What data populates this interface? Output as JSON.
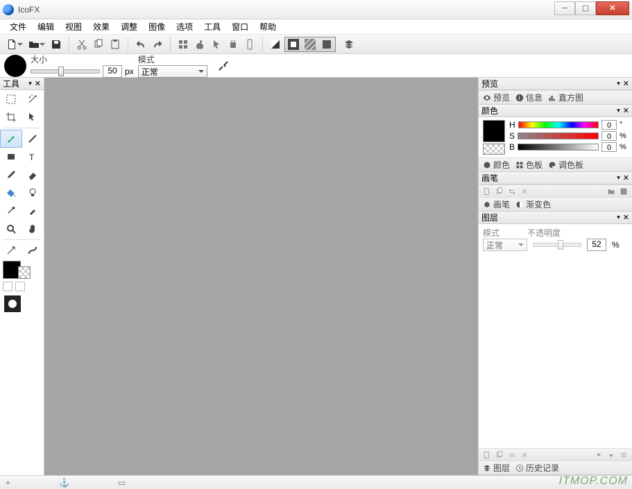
{
  "title": "IcoFX",
  "menu": [
    "文件",
    "编辑",
    "视图",
    "效果",
    "调整",
    "图像",
    "选项",
    "工具",
    "窗口",
    "帮助"
  ],
  "brush": {
    "sizeLabel": "大小",
    "sizeValue": "50",
    "sizeUnit": "px",
    "modeLabel": "模式",
    "modeValue": "正常"
  },
  "toolbox": {
    "title": "工具"
  },
  "preview": {
    "title": "预览",
    "tabs": [
      "预览",
      "信息",
      "直方图"
    ]
  },
  "color": {
    "title": "颜色",
    "rows": [
      {
        "label": "H",
        "value": "0",
        "unit": "°"
      },
      {
        "label": "S",
        "value": "0",
        "unit": "%"
      },
      {
        "label": "B",
        "value": "0",
        "unit": "%"
      }
    ],
    "tabs": [
      "颜色",
      "色板",
      "调色板"
    ]
  },
  "brushPanel": {
    "title": "画笔",
    "tabs": [
      "画笔",
      "渐变色"
    ]
  },
  "layer": {
    "title": "图层",
    "modeLabel": "模式",
    "modeValue": "正常",
    "opacityLabel": "不透明度",
    "opacityValue": "52",
    "opacityUnit": "%",
    "tabs": [
      "图层",
      "历史记录"
    ]
  },
  "watermark": "ITMOP.COM",
  "statusIcons": [
    "+",
    "⚓",
    "▭"
  ]
}
